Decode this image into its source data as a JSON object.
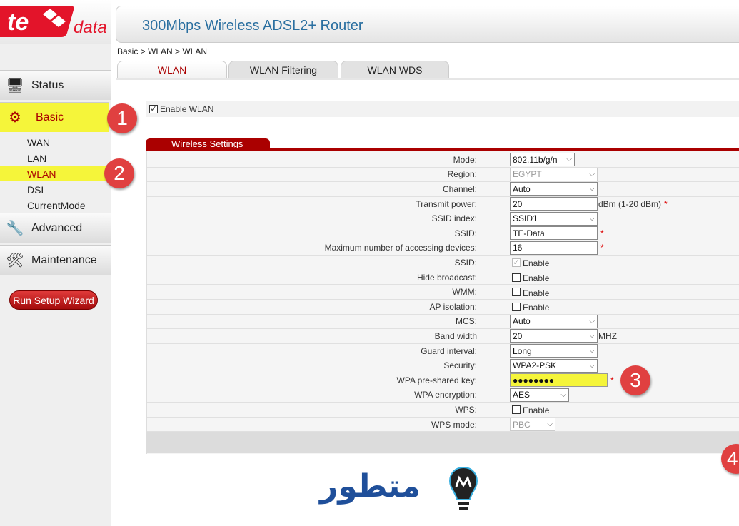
{
  "logo": {
    "text": "te data"
  },
  "header": {
    "title": "300Mbps Wireless ADSL2+ Router"
  },
  "breadcrumb": "Basic > WLAN > WLAN",
  "tabs": [
    {
      "label": "WLAN",
      "active": true
    },
    {
      "label": "WLAN Filtering"
    },
    {
      "label": "WLAN WDS"
    }
  ],
  "sidebar": {
    "menus": [
      {
        "label": "Status",
        "icon": "status-icon"
      },
      {
        "label": "Basic",
        "icon": "gear-icon",
        "highlighted": true
      },
      {
        "label": "Advanced",
        "icon": "advanced-icon"
      },
      {
        "label": "Maintenance",
        "icon": "maintenance-icon"
      }
    ],
    "basic_items": [
      "WAN",
      "LAN",
      "WLAN",
      "DSL",
      "CurrentMode"
    ],
    "wizard": "Run Setup Wizard"
  },
  "badges": [
    "1",
    "2",
    "3",
    "4"
  ],
  "enable_wlan": {
    "label": "Enable WLAN",
    "checked": true
  },
  "section_title": "Wireless Settings",
  "fields": [
    {
      "label": "Mode:",
      "type": "select",
      "value": "802.11b/g/n"
    },
    {
      "label": "Region:",
      "type": "select",
      "value": "EGYPT",
      "disabled": true
    },
    {
      "label": "Channel:",
      "type": "select",
      "value": "Auto"
    },
    {
      "label": "Transmit power:",
      "type": "input",
      "value": "20",
      "suffix": "dBm (1-20 dBm)",
      "required": true
    },
    {
      "label": "SSID index:",
      "type": "select",
      "value": "SSID1"
    },
    {
      "label": "SSID:",
      "type": "input",
      "value": "TE-Data",
      "required": true
    },
    {
      "label": "Maximum number of accessing devices:",
      "type": "input",
      "value": "16",
      "required": true
    },
    {
      "label": "SSID:",
      "type": "checkbox",
      "value": "Enable",
      "checked": true,
      "disabled": true
    },
    {
      "label": "Hide broadcast:",
      "type": "checkbox",
      "value": "Enable"
    },
    {
      "label": "WMM:",
      "type": "checkbox",
      "value": "Enable"
    },
    {
      "label": "AP isolation:",
      "type": "checkbox",
      "value": "Enable"
    },
    {
      "label": "MCS:",
      "type": "select",
      "value": "Auto"
    },
    {
      "label": "Band width",
      "type": "select",
      "value": "20",
      "suffix": "MHZ"
    },
    {
      "label": "Guard interval:",
      "type": "select",
      "value": "Long"
    },
    {
      "label": "Security:",
      "type": "select",
      "value": "WPA2-PSK"
    },
    {
      "label": "WPA pre-shared key:",
      "type": "password",
      "value": "●●●●●●●●",
      "required": true,
      "highlighted": true
    },
    {
      "label": "WPA encryption:",
      "type": "select",
      "value": "AES",
      "narrow": true
    },
    {
      "label": "WPS:",
      "type": "checkbox",
      "value": "Enable"
    },
    {
      "label": "WPS mode:",
      "type": "select",
      "value": "PBC",
      "disabled": true,
      "small": true
    }
  ],
  "watermark": {
    "text": "متطور"
  },
  "colors": {
    "accent": "#aa0000",
    "highlight": "#f5f53a",
    "badge": "#e04040",
    "title": "#2a6fa0"
  }
}
